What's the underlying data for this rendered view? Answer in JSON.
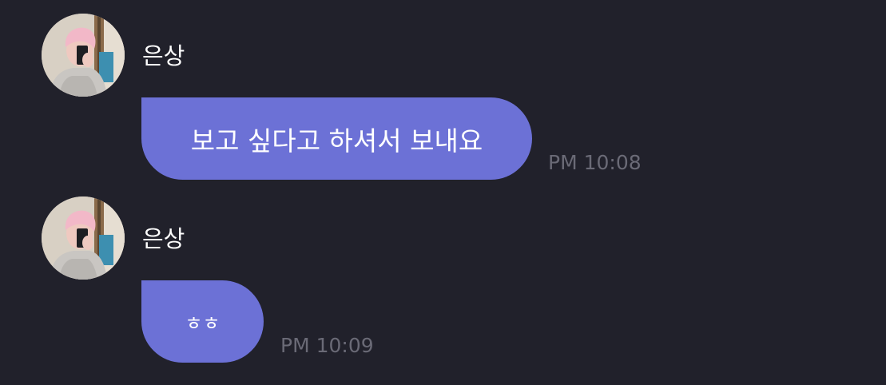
{
  "colors": {
    "background": "#21212b",
    "bubble": "#6c71d6",
    "name_text": "#ffffff",
    "time_text": "#6a6a76"
  },
  "messages": [
    {
      "sender": "은상",
      "avatar_icon": "profile-photo",
      "text": "보고 싶다고 하셔서 보내요",
      "time": "PM 10:08"
    },
    {
      "sender": "은상",
      "avatar_icon": "profile-photo",
      "text": "ㅎㅎ",
      "time": "PM 10:09"
    }
  ]
}
